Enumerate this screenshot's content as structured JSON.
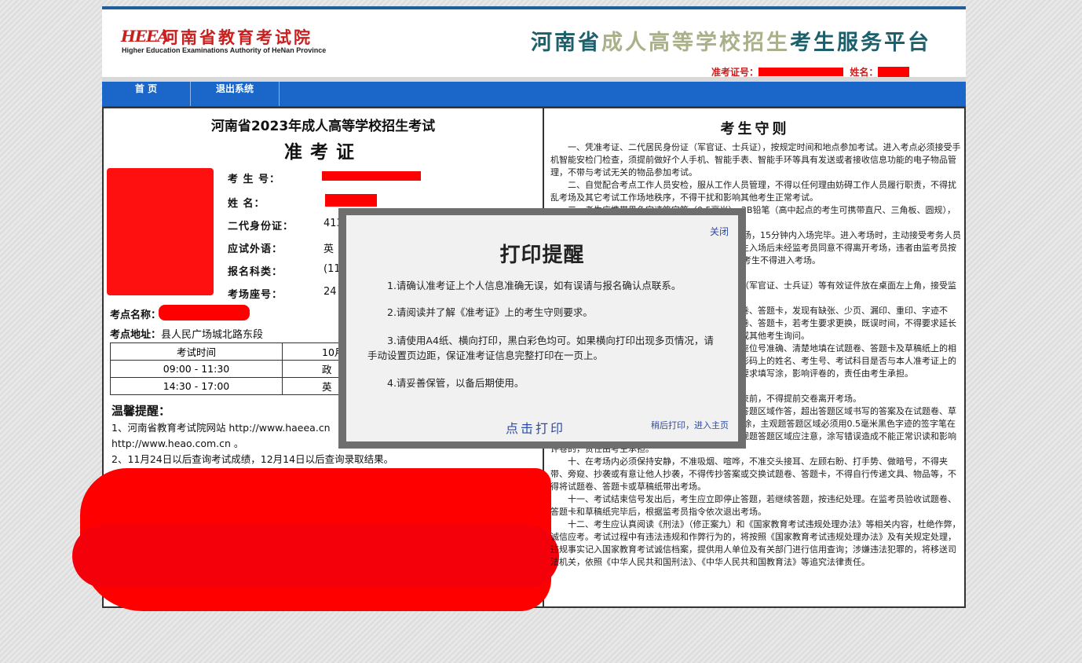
{
  "header": {
    "logo_mark": "HEEA",
    "logo_cn": "河南省教育考试院",
    "logo_en": "Higher Education Examinations Authority of HeNan Province",
    "platform_p1": "河南省",
    "platform_p2": "成人高等学校招生",
    "platform_p3": "考生服务平台",
    "ticket_label": "准考证号：",
    "name_label": "姓名："
  },
  "nav": {
    "home": "首  页",
    "logout": "退出系统"
  },
  "admission": {
    "exam_title": "河南省2023年成人高等学校招生考试",
    "card_title": "准考证",
    "fields": [
      {
        "label": "考 生 号：",
        "value": ""
      },
      {
        "label": "姓    名：",
        "value": ""
      },
      {
        "label": "二代身份证：",
        "value": "413"
      },
      {
        "label": "应试外语：",
        "value": "英"
      },
      {
        "label": "报名科类：",
        "value": "(11"
      },
      {
        "label": "考场座号：",
        "value": "24"
      }
    ],
    "site_name_label": "考点名称：",
    "site_addr_label": "考点地址：",
    "site_addr_value": "县人民广场城北路东段",
    "schedule": {
      "header": [
        "考试时间",
        "10月"
      ],
      "rows": [
        [
          "09:00 - 11:30",
          "政"
        ],
        [
          "14:30 - 17:00",
          "英"
        ]
      ]
    },
    "tips_title": "温馨提醒：",
    "tips": [
      "1、河南省教育考试院网站 http://www.haeea.cn",
      "http://www.heao.com.cn 。",
      "2、11月24日以后查询考试成绩，12月14日以后查询录取结果。"
    ]
  },
  "rules": {
    "title": "考生守则",
    "items": [
      "一、凭准考证、二代居民身份证（军官证、士兵证），按规定时间和地点参加考试。进入考点必须接受手机智能安检门检查，须提前做好个人手机、智能手表、智能手环等具有发送或者接收信息功能的电子物品管理，不带与考试无关的物品参加考试。",
      "二、自觉配合考点工作人员安检，服从工作人员管理，不得以任何理由妨碍工作人员履行职责，不得扰乱考场及其它考试工作场地秩序，不得干扰和影响其他考生正常考试。",
      "三、考生应携带黑色字迹签字笔（0.5毫米）、2B铅笔（高中起点的考生可携带直尺、三角板、圆规），其它任何物品不准带入考场。",
      "四、考试开始前20分钟，考生凭准考证进入考场，15分钟内入场完毕。进入考场时，主动接受考务人员核查，如携带手机等与考试无关物品进入考场。考生入场后未经监考员同意不得离开考场，违者由监考员按照监考员指令依次离开考场。开考15分钟后，迟到考生不得进入考场。",
      "五、考生入场后，将准考证、二代居民身份证（军官证、士兵证）等有效证件放在桌面左上角，接受监考员核验。",
      "六、考生领到试题卷、答题卡后，先检查试题卷、答题卡，发现有缺张、少页、漏印、重印、字迹不清、破损等情况，应立即举手报告，不准更换试题卷、答题卡，若考生要求更换，既误时间，不得要求延长考试时间。不得就试题内容的疑问，不得向监考员或其他考生询问。",
      "七、开考信号发出后方可答题。考生应在指定座位号准确、清楚地填在试题卷、答题卡及草稿纸上的相应位置，并在答题卡上粘贴条形码，应认真核对条形码上的姓名、考生号、考试科目是否与本人准考证上的信息一致，无误后粘贴在答题卡规定位置。若不按要求填写涂，影响评卷的，责任由考生承担。",
      "八、考试期间，考生不得提前交卷，在考试结束前，不得提前交卷离开考场。",
      "九、考生须按照题号在答题卡上各题目指示的答题区域作答，超出答题区域书写的答案及在试题卷、草稿纸上作答的答案无效。答题区域必须用2B铅笔填涂，主观题答题区域必须用0.5毫米黑色字迹的签字笔在答题卡规定答题，不得在答题卡上做任何标记。客观题答题区域应注意，涂写错误造成不能正常识读和影响评卷的，责任由考生承担。",
      "十、在考场内必须保持安静，不准吸烟、喧哗，不准交头接耳、左顾右盼、打手势、做暗号，不得夹带、旁窥、抄袭或有意让他人抄袭，不得传抄答案或交换试题卷、答题卡，不得自行传递文具、物品等，不得将试题卷、答题卡或草稿纸带出考场。",
      "十一、考试结束信号发出后，考生应立即停止答题，若继续答题，按违纪处理。在监考员验收试题卷、答题卡和草稿纸完毕后，根据监考员指令依次退出考场。",
      "十二、考生应认真阅读《刑法》（修正案九）和《国家教育考试违规处理办法》等相关内容，杜绝作弊，诚信应考。考试过程中有违法违规和作弊行为的，将按照《国家教育考试违规处理办法》及有关规定处理，违规事实记入国家教育考试诚信档案，提供用人单位及有关部门进行信用查询；涉嫌违法犯罪的，将移送司法机关，依照《中华人民共和国刑法》、《中华人民共和国教育法》等追究法律责任。"
    ]
  },
  "modal": {
    "close": "关闭",
    "title": "打印提醒",
    "items": [
      "1.请确认准考证上个人信息准确无误，如有误请与报名确认点联系。",
      "2.请阅读并了解《准考证》上的考生守则要求。",
      "3.请使用A4纸、横向打印，黑白彩色均可。如果横向打印出现多页情况，请手动设置页边距，保证准考证信息完整打印在一页上。",
      "4.请妥善保管，以备后期使用。"
    ],
    "print": "点击打印",
    "later": "稍后打印，进入主页"
  },
  "colors": {
    "brand_red": "#c8201f",
    "nav_blue": "#1b67c9",
    "link_blue": "#2c4aa8",
    "redaction": "#ff0000"
  }
}
